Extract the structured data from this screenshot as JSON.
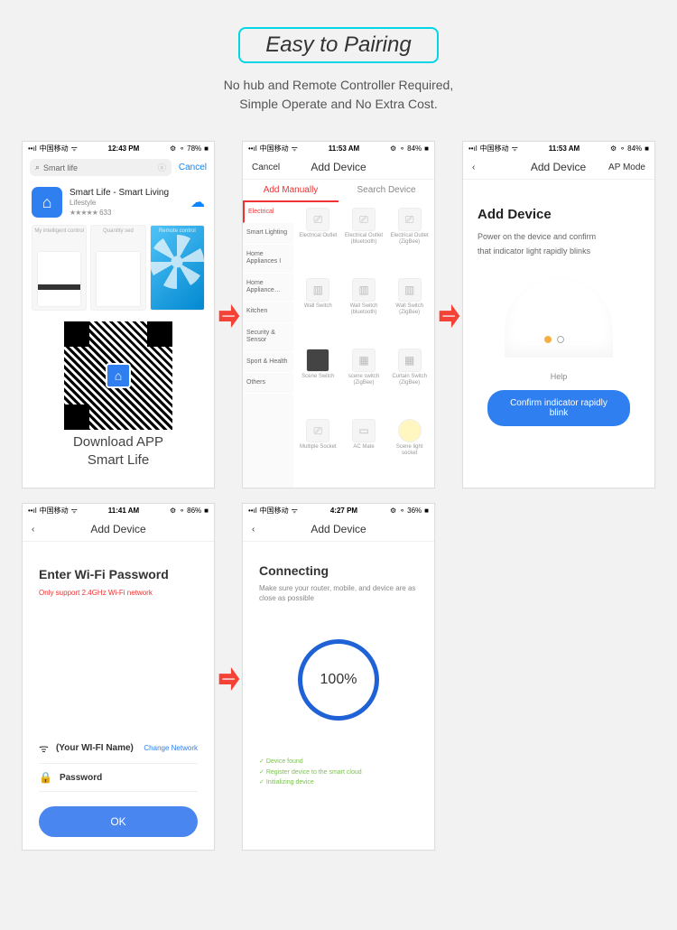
{
  "header": {
    "title": "Easy to Pairing",
    "subtitle_l1": "No hub and Remote Controller Required,",
    "subtitle_l2": "Simple Operate and No Extra Cost."
  },
  "phone1": {
    "carrier": "中国移动",
    "time": "12:43 PM",
    "battery": "78%",
    "search_text": "Smart life",
    "cancel": "Cancel",
    "app_name": "Smart Life - Smart Living",
    "app_category": "Lifestyle",
    "ratings": "633",
    "shot_labels": [
      "My intelligent control",
      "Quantity sed",
      "Remote control"
    ],
    "download_l1": "Download APP",
    "download_l2": "Smart Life"
  },
  "phone2": {
    "carrier": "中国移动",
    "time": "11:53 AM",
    "battery": "84%",
    "cancel": "Cancel",
    "title": "Add Device",
    "tab_manual": "Add Manually",
    "tab_search": "Search Device",
    "categories": [
      "Electrical",
      "Smart Lighting",
      "Home Appliances I",
      "Home Appliance…",
      "Kitchen",
      "Security & Sensor",
      "Sport & Health",
      "Others"
    ],
    "devices": [
      "Electrical Outlet",
      "Electrical Outlet (bluetooth)",
      "Electrical Outlet (ZigBee)",
      "Wall Switch",
      "Wall Switch (bluetooth)",
      "Wall Switch (ZigBee)",
      "Scene Switch",
      "scene switch (ZigBee)",
      "Curtain Switch (ZigBee)",
      "Multiple Socket",
      "AC Mate",
      "Scene light socket"
    ]
  },
  "phone3": {
    "carrier": "中国移动",
    "time": "11:53 AM",
    "battery": "84%",
    "nav_title": "Add Device",
    "nav_right": "AP Mode",
    "title": "Add Device",
    "desc_l1": "Power on the device and confirm",
    "desc_l2": "that indicator light rapidly blinks",
    "help": "Help",
    "button": "Confirm indicator rapidly blink"
  },
  "phone4": {
    "carrier": "中国移动",
    "time": "11:41 AM",
    "battery": "86%",
    "nav_title": "Add Device",
    "title": "Enter Wi-Fi Password",
    "note": "Only support 2.4GHz Wi-Fi network",
    "wifi_name": "(Your WI-FI Name)",
    "change": "Change Network",
    "password_label": "Password",
    "ok": "OK"
  },
  "phone5": {
    "carrier": "中国移动",
    "time": "4:27 PM",
    "battery": "36%",
    "nav_title": "Add Device",
    "title": "Connecting",
    "note": "Make sure your router, mobile, and device are as close as possible",
    "percent": "100%",
    "check1": "Device found",
    "check2": "Register device to the smart cloud",
    "check3": "Initializing device"
  }
}
